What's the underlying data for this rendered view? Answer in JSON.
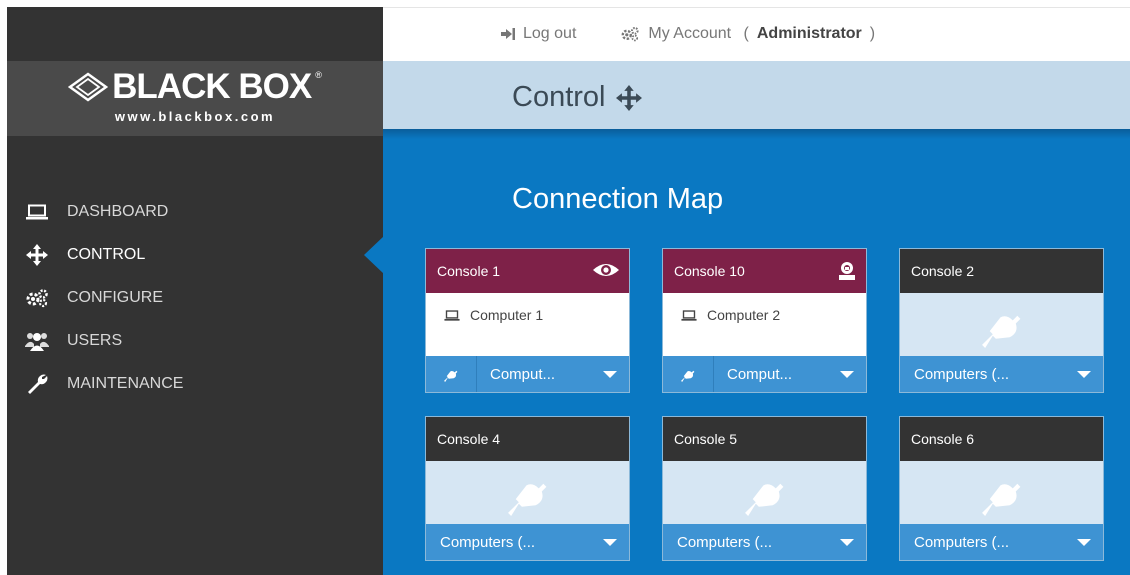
{
  "colors": {
    "sidebar": "#333333",
    "logo_band": "#4a4a4a",
    "main_bg": "#0a78c2",
    "titlebar_bg": "#c3d9ea",
    "active_console": "#7e2148",
    "idle_console": "#333333",
    "card_footer": "#3e93d3",
    "empty_body": "#d6e6f3"
  },
  "brand": {
    "name": "BLACK BOX",
    "registered": "®",
    "url": "www.blackbox.com",
    "icon": "diamond-logo-icon"
  },
  "nav": [
    {
      "label": "DASHBOARD",
      "icon": "laptop-icon",
      "active": false
    },
    {
      "label": "CONTROL",
      "icon": "move-arrows-icon",
      "active": true
    },
    {
      "label": "CONFIGURE",
      "icon": "gears-icon",
      "active": false
    },
    {
      "label": "USERS",
      "icon": "users-icon",
      "active": false
    },
    {
      "label": "MAINTENANCE",
      "icon": "wrench-icon",
      "active": false
    }
  ],
  "header": {
    "logout": {
      "label": "Log out",
      "icon": "logout-icon"
    },
    "account": {
      "label": "My Account",
      "role_open": " (",
      "role": "Administrator",
      "role_close": ")",
      "icon": "gears-icon"
    }
  },
  "page": {
    "title": "Control",
    "title_icon": "move-arrows-icon",
    "heading": "Connection Map"
  },
  "consoles": [
    {
      "name": "Console 1",
      "state": "connected",
      "status_icon": "eye-icon",
      "computer": "Computer 1",
      "computer_icon": "laptop-icon",
      "selector": "Comput..."
    },
    {
      "name": "Console 10",
      "state": "connected",
      "status_icon": "user-lock-icon",
      "computer": "Computer 2",
      "computer_icon": "laptop-icon",
      "selector": "Comput..."
    },
    {
      "name": "Console 2",
      "state": "idle",
      "body_icon": "plug-icon",
      "selector": "Computers (..."
    },
    {
      "name": "Console 4",
      "state": "idle",
      "body_icon": "plug-icon",
      "selector": "Computers (..."
    },
    {
      "name": "Console 5",
      "state": "idle",
      "body_icon": "plug-icon",
      "selector": "Computers (..."
    },
    {
      "name": "Console 6",
      "state": "idle",
      "body_icon": "plug-icon",
      "selector": "Computers (..."
    }
  ]
}
